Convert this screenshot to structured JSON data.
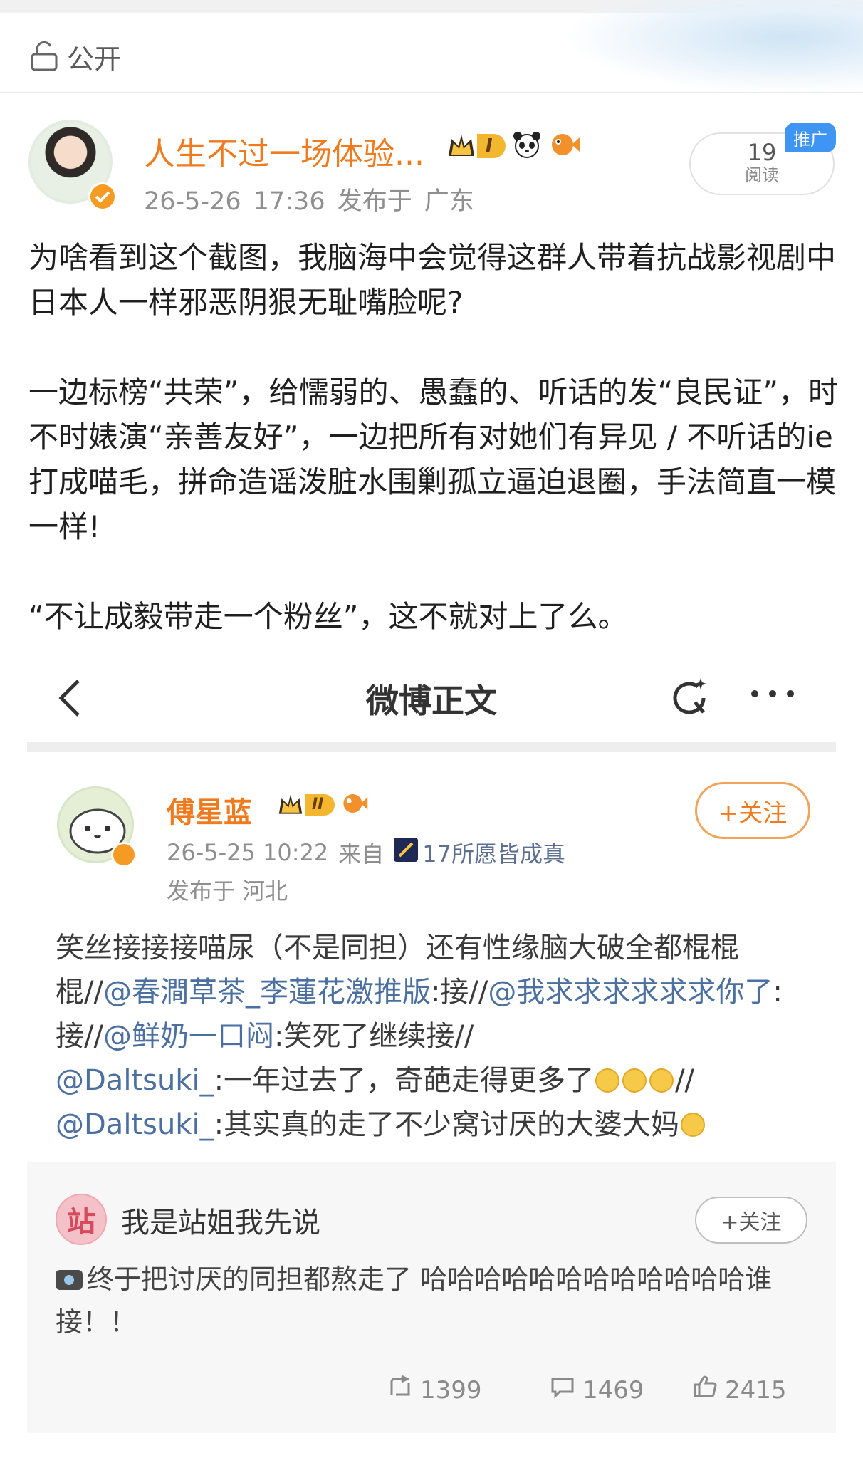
{
  "topbar": {
    "visibility_label": "公开"
  },
  "post": {
    "author": "人生不过一场体验...",
    "level_badge": "I",
    "timestamp": "26-5-26 17:36",
    "location": "发布于 广东",
    "reads": {
      "count": "19",
      "label": "阅读"
    },
    "promo_tag": "推广",
    "paragraphs": [
      "为啥看到这个截图，我脑海中会觉得这群人带着抗战影视剧中日本人一样邪恶阴狠无耻嘴脸呢?",
      "",
      "一边标榜“共荣”，给懦弱的、愚蠢的、听话的发“良民证”，时不时婊演“亲善友好”，一边把所有对她们有异见 / 不听话的ie打成喵毛，拼命造谣泼脏水围剿孤立逼迫退圈，手法简直一模一样!",
      "",
      "“不让成毅带走一个粉丝”，这不就对上了么。"
    ]
  },
  "screenshot": {
    "nav_title": "微博正文",
    "author": "傅星蓝",
    "level_badge": "II",
    "timestamp": "26-5-25 10:22",
    "source_prefix": "来自",
    "source": "17所愿皆成真",
    "location": "发布于 河北",
    "follow_label": "+关注",
    "text": {
      "t1": "笑丝接接接喵尿（不是同担）还有性缘脑大破全都棍棍棍//",
      "l1": "@春澗草茶_李蓮花激推版",
      "t2": ":接//",
      "l2": "@我求求求求求求你了",
      "t3": ":接//",
      "l3": "@鲜奶一口闷",
      "t4": ":笑死了继续接//",
      "l4": "@Daltsuki_",
      "t5": ":一年过去了，奇葩走得更多了",
      "t6": "//",
      "l5": "@Daltsuki_",
      "t7": ":其实真的走了不少窝讨厌的大婆大妈"
    },
    "quoted": {
      "avatar_char": "站",
      "name": "我是站姐我先说",
      "follow_label": "+关注",
      "text": "终于把讨厌的同担都熬走了 哈哈哈哈哈哈哈哈哈哈哈哈谁接！！",
      "reposts": "1399",
      "comments": "1469",
      "likes": "2415"
    }
  },
  "colors": {
    "accent_orange": "#f07a1e",
    "link_blue": "#4a6fa0",
    "promo_blue": "#3e95f4"
  }
}
